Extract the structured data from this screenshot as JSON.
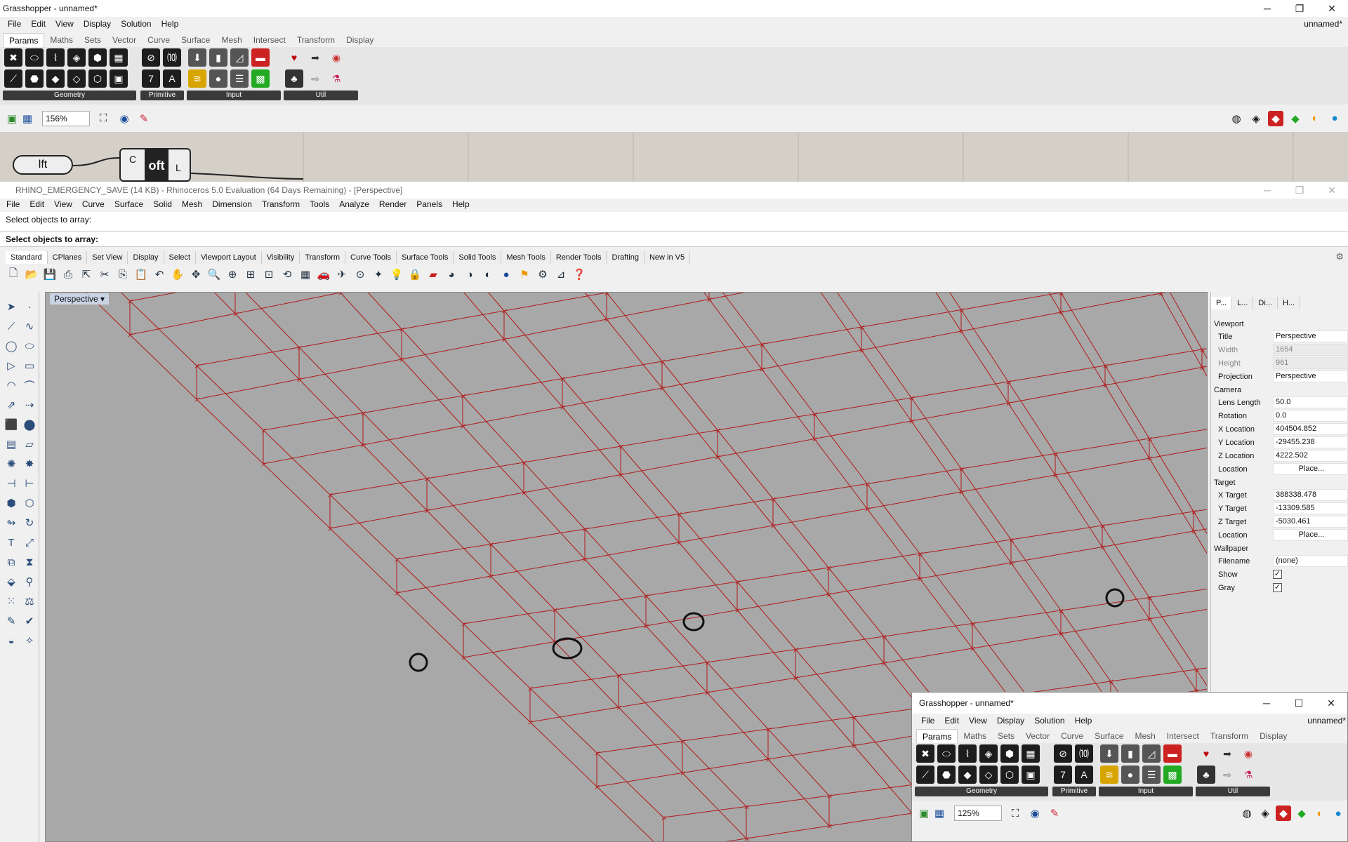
{
  "gh_top": {
    "title": "Grasshopper - unnamed*",
    "doc_name": "unnamed*",
    "menu": [
      "File",
      "Edit",
      "View",
      "Display",
      "Solution",
      "Help"
    ],
    "tabs": [
      "Params",
      "Maths",
      "Sets",
      "Vector",
      "Curve",
      "Surface",
      "Mesh",
      "Intersect",
      "Transform",
      "Display"
    ],
    "groups": [
      "Geometry",
      "Primitive",
      "Input",
      "Util"
    ],
    "zoom": "156%",
    "canvas_nodes": {
      "lft": "lft",
      "loft_inputs": [
        "C",
        "L"
      ],
      "loft_label": "oft"
    }
  },
  "rhino": {
    "title": "RHINO_EMERGENCY_SAVE (14 KB) - Rhinoceros 5.0 Evaluation (64 Days Remaining) - [Perspective]",
    "menu": [
      "File",
      "Edit",
      "View",
      "Curve",
      "Surface",
      "Solid",
      "Mesh",
      "Dimension",
      "Transform",
      "Tools",
      "Analyze",
      "Render",
      "Panels",
      "Help"
    ],
    "command_history": "Select objects to array:",
    "command_prompt": "Select objects to array:",
    "toolbar_tabs": [
      "Standard",
      "CPlanes",
      "Set View",
      "Display",
      "Select",
      "Viewport Layout",
      "Visibility",
      "Transform",
      "Curve Tools",
      "Surface Tools",
      "Solid Tools",
      "Mesh Tools",
      "Render Tools",
      "Drafting",
      "New in V5"
    ],
    "viewport_label": "Perspective"
  },
  "properties": {
    "tabs": [
      "P...",
      "L...",
      "Di...",
      "H..."
    ],
    "viewport_section": "Viewport",
    "title_label": "Title",
    "title_value": "Perspective",
    "width_label": "Width",
    "width_value": "1654",
    "height_label": "Height",
    "height_value": "961",
    "projection_label": "Projection",
    "projection_value": "Perspective",
    "camera_section": "Camera",
    "lens_label": "Lens Length",
    "lens_value": "50.0",
    "rotation_label": "Rotation",
    "rotation_value": "0.0",
    "xloc_label": "X Location",
    "xloc_value": "404504.852",
    "yloc_label": "Y Location",
    "yloc_value": "-29455.238",
    "zloc_label": "Z Location",
    "zloc_value": "4222.502",
    "location_label": "Location",
    "place_button": "Place...",
    "target_section": "Target",
    "xt_label": "X Target",
    "xt_value": "388338.478",
    "yt_label": "Y Target",
    "yt_value": "-13309.585",
    "zt_label": "Z Target",
    "zt_value": "-5030.461",
    "tlocation_label": "Location",
    "wallpaper_section": "Wallpaper",
    "filename_label": "Filename",
    "filename_value": "(none)",
    "browse_button": "...",
    "show_label": "Show",
    "gray_label": "Gray"
  },
  "gh_bottom": {
    "title": "Grasshopper - unnamed*",
    "doc_name": "unnamed*",
    "menu": [
      "File",
      "Edit",
      "View",
      "Display",
      "Solution",
      "Help"
    ],
    "tabs": [
      "Params",
      "Maths",
      "Sets",
      "Vector",
      "Curve",
      "Surface",
      "Mesh",
      "Intersect",
      "Transform",
      "Display"
    ],
    "groups": [
      "Geometry",
      "Primitive",
      "Input",
      "Util"
    ],
    "zoom": "125%"
  },
  "colors": {
    "curve": "#b01a1a",
    "viewport_bg": "#a8a8a8",
    "canvas_bg": "#d4d0c8"
  },
  "icons": {
    "min": "─",
    "max": "☐",
    "restore": "❐",
    "close": "✕"
  }
}
